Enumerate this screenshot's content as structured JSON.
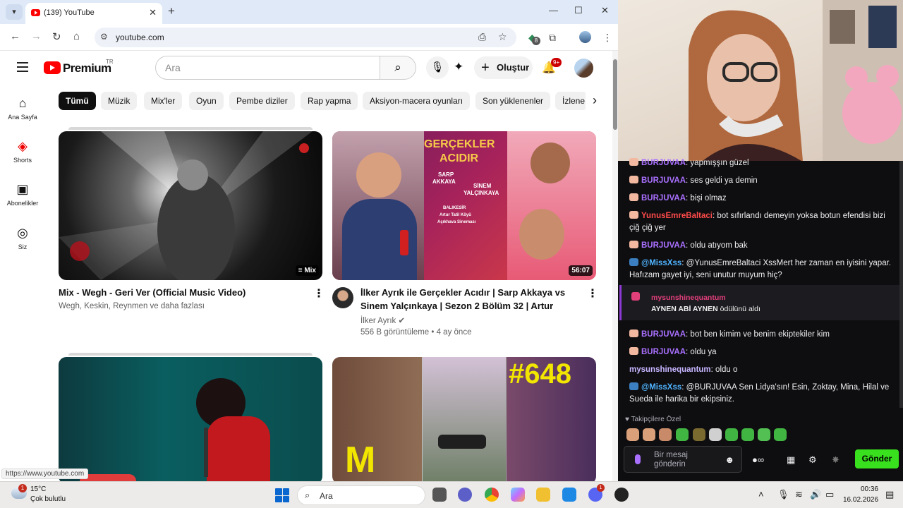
{
  "browser": {
    "tab_title": "(139) YouTube",
    "url": "youtube.com",
    "extension_badge": "8",
    "status_url": "https://www.youtube.com"
  },
  "youtube": {
    "logo_text": "Premium",
    "logo_region": "TR",
    "search_placeholder": "Ara",
    "create_label": "Oluştur",
    "notification_count": "9+",
    "rail": [
      {
        "label": "Ana Sayfa",
        "icon": "home-icon"
      },
      {
        "label": "Shorts",
        "icon": "shorts-icon"
      },
      {
        "label": "Abonelikler",
        "icon": "subscriptions-icon"
      },
      {
        "label": "Siz",
        "icon": "user-icon"
      }
    ],
    "chips": [
      "Tümü",
      "Müzik",
      "Mix'ler",
      "Oyun",
      "Pembe diziler",
      "Rap yapma",
      "Aksiyon-macera oyunları",
      "Son yüklenenler",
      "İzlene"
    ],
    "videos": [
      {
        "title": "Mix - Wegh - Geri Ver (Official Music Video)",
        "meta": "Wegh, Keskin, Reynmen ve daha fazlası",
        "badge": "Mix"
      },
      {
        "title_line1": "İlker Ayrık ile Gerçekler Acıdır | Sarp Akkaya vs",
        "title_line2": "Sinem Yalçınkaya | Sezon 2 Bölüm 32 | Artur",
        "channel": "İlker Ayrık",
        "stats": "556 B görüntüleme • 4 ay önce",
        "badge": "56:07",
        "thumb_text": [
          "GERÇEKLER",
          "ACIDIR",
          "SARP",
          "AKKAYA",
          "SİNEM",
          "YALÇINKAYA",
          "BALIKESİR",
          "Artur Tatil Köyü",
          "Açıkhava Sineması"
        ]
      },
      {
        "thumb_text": [
          "#648"
        ]
      }
    ]
  },
  "chat": {
    "messages": [
      {
        "user": "BURJUVAA",
        "text": ": yapmışşın güzel",
        "color": "purple"
      },
      {
        "user": "BURJUVAA",
        "text": ": ses geldi ya demin",
        "color": "purple"
      },
      {
        "user": "BURJUVAA",
        "text": ": bişi olmaz",
        "color": "purple"
      },
      {
        "user": "YunusEmreBaltaci",
        "text": ": bot sıfırlandı demeyin yoksa botun efendisi bizi çiğ çiğ yer",
        "color": "red"
      },
      {
        "user": "BURJUVAA",
        "text": ": oldu atıyom bak",
        "color": "purple"
      },
      {
        "user": "@MissXss",
        "text": ": @YunusEmreBaltaci XssMert her zaman en iyisini yapar. Hafızam gayet iyi, seni unutur muyum hiç?",
        "color": "cyan"
      }
    ],
    "redeem": {
      "user": "mysunshinequantum",
      "reward": "AYNEN ABİ AYNEN",
      "suffix": " ödülünü aldı"
    },
    "messages2": [
      {
        "user": "BURJUVAA",
        "text": ": bot ben kimim ve benim ekiptekiler kim",
        "color": "purple"
      },
      {
        "user": "BURJUVAA",
        "text": ": oldu ya",
        "color": "purple"
      },
      {
        "user": "mysunshinequantum",
        "text": ": oldu o",
        "color": "plain"
      },
      {
        "user": "@MissXss",
        "text": ": @BURJUVAA Sen Lidya'sın! Esin, Zoktay, Mina, Hilal ve Sueda ile harika bir ekipsiniz.",
        "color": "cyan"
      }
    ],
    "emote_header": "Takipçilere Özel",
    "input_placeholder": "Bir mesaj gönderin",
    "send_label": "Gönder"
  },
  "taskbar": {
    "temperature": "15°C",
    "weather": "Çok bulutlu",
    "weather_badge": "1",
    "search_label": "Ara",
    "discord_badge": "1",
    "time": "00:36",
    "date": "16.02.2026"
  }
}
